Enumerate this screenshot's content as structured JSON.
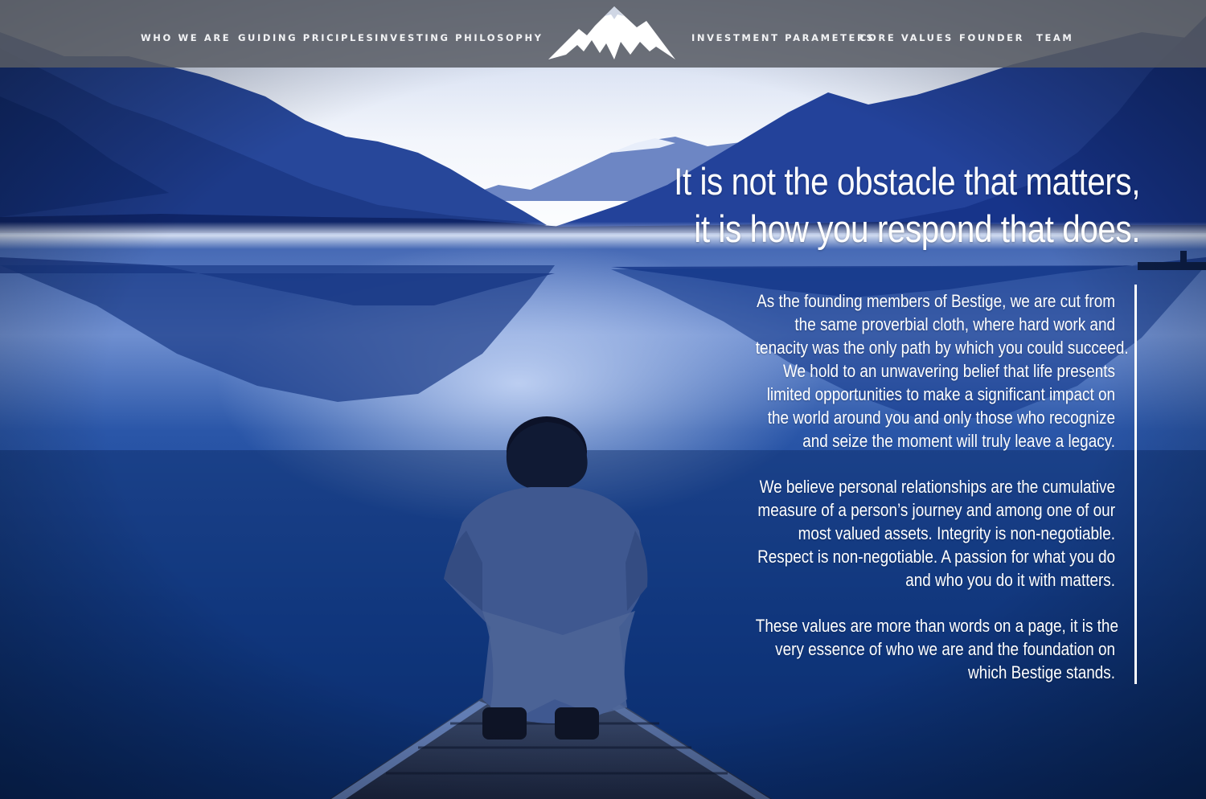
{
  "nav": {
    "left": [
      "WHO WE ARE",
      "GUIDING PRICIPLES",
      "INVESTING PHILOSOPHY"
    ],
    "right": [
      "INVESTMENT PARAMETERS",
      "CORE VALUES",
      "FOUNDER",
      "TEAM"
    ]
  },
  "logo": {
    "name": "mountain-logo-icon"
  },
  "headline": {
    "line1": "It is not the obstacle that matters,",
    "line2": "it is how you respond that does."
  },
  "body": {
    "paragraphs": [
      [
        "As the founding members of Bestige, we are cut from",
        "the same proverbial cloth, where hard work and",
        "tenacity was the only path by which you could succeed.",
        "We hold to an unwavering belief that life presents",
        "limited opportunities to make a significant impact on",
        "the world around you and only those who recognize",
        "and seize the moment will truly leave a legacy."
      ],
      [
        "We believe personal relationships are the cumulative",
        "measure of a person’s journey and among one of our",
        "most valued assets.  Integrity is non-negotiable.",
        "Respect is non-negotiable.  A passion for what you do",
        "and who you do it with matters."
      ],
      [
        "These values are more than words on a page, it is the",
        "very essence of who we are and the foundation on",
        "which Bestige stands."
      ]
    ]
  },
  "colors": {
    "nav_bg": "#585c64",
    "text": "#ffffff",
    "sky": "#f4f6fb",
    "mountain": "#1f3c8c",
    "water": "#123a8a"
  }
}
